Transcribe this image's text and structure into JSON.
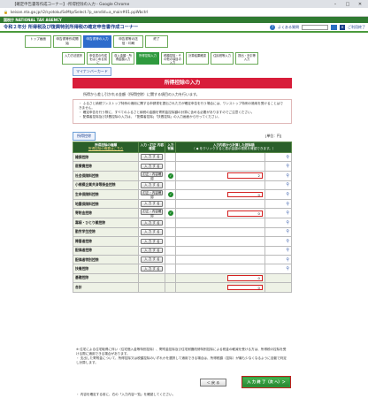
{
  "window": {
    "title": "【確定申告書等作成コーナー】-所得控除の入力 - Google Chrome",
    "url": "keisan.nta.go.jp/r2/syotoku/SsMtp/Select.?p_sendid=a_main#01.ppWbctrl"
  },
  "header": {
    "agency": "国税庁  NATIONAL TAX AGENCY",
    "app_title": "令和２年分  所得税及び復興特別所得税の確定申告書作成コーナー",
    "help_label": "よくある質問",
    "close_label": "ご利用終了"
  },
  "steps_top": [
    {
      "label": "トップ画面"
    },
    {
      "label": "申告書等作成開始"
    },
    {
      "label": "申告書等の入力",
      "current": true
    },
    {
      "label": "申告書等の送信・印刷"
    },
    {
      "label": "終了"
    }
  ],
  "steps_sub": [
    {
      "label": "入力方法選択"
    },
    {
      "label": "申告書の作成をはじめる前に"
    },
    {
      "label": "収入金額・所得金額入力"
    },
    {
      "label": "所得控除入力",
      "current": true
    },
    {
      "label": "税額控除・その他の項目の入力"
    },
    {
      "label": "計算結果確認"
    },
    {
      "label": "住民税等入力"
    },
    {
      "label": "提出・天引等入力"
    }
  ],
  "mynumber_label": "マイナンバーカード",
  "page_title": "所得控除の入力",
  "intro": "所得から差し引かれる金額（所得控除）に関する項目の入力を行います。",
  "notes": [
    "・ ふるさと納税ワンストップ特例の適用に関する申請書を提出された方が確定申告を行う場合には、ワンストップ特例の適用を受けることはできません。",
    "・ 確定申告を行う際に、すべてのふるさと納税の金額を寄附金控除額の計算に含める必要がありますのでご注意ください。",
    "・ 配偶者控除及び扶養控除の入力は、「配偶者控除」「扶養控除」の入力画面から行ってください。"
  ],
  "tab_label": "所得控除",
  "unit_label": "[単位：円]",
  "table": {
    "headers": {
      "kind": "所得控除の種類",
      "kind_link": "所得控除の概要はこちら",
      "input": "入力・訂正 内容確認",
      "entered": "入力 有無",
      "amount": "入力内容から計算した控除額",
      "amount_note": "（ ◆ をクリックすると表示金額の根拠を確認できます。）"
    },
    "rows": [
      {
        "name": "雑損控除",
        "button": "入 力 す る",
        "checked": false,
        "amount": ""
      },
      {
        "name": "医療費控除",
        "button": "入 力 す る",
        "checked": false,
        "amount": ""
      },
      {
        "name": "社会保険料控除",
        "button": "訂正・内容確認",
        "checked": true,
        "amount": "2"
      },
      {
        "name": "小規模企業共済等掛金控除",
        "button": "入 力 す る",
        "checked": false,
        "amount": ""
      },
      {
        "name": "生命保険料控除",
        "button": "訂正・内容確認",
        "checked": true,
        "amount": "0"
      },
      {
        "name": "地震保険料控除",
        "button": "入 力 す る",
        "checked": false,
        "amount": ""
      },
      {
        "name": "寄附金控除",
        "button": "訂正・内容確認",
        "checked": true,
        "amount": "0"
      },
      {
        "name": "寡婦・ひとり親控除",
        "button": "入 力 す る",
        "checked": false,
        "amount": ""
      },
      {
        "name": "勤労学生控除",
        "button": "入 力 す る",
        "checked": false,
        "amount": ""
      },
      {
        "name": "障害者控除",
        "button": "入 力 す る",
        "checked": false,
        "amount": ""
      },
      {
        "name": "配偶者控除",
        "button": "入 力 す る",
        "checked": false,
        "amount": ""
      },
      {
        "name": "配偶者特別控除",
        "button": "入 力 す る",
        "checked": false,
        "amount": ""
      },
      {
        "name": "扶養控除",
        "button": "入 力 す る",
        "checked": false,
        "amount": ""
      },
      {
        "name": "基礎控除",
        "button": "",
        "checked": false,
        "amount": "0"
      },
      {
        "name": "合計",
        "button": "",
        "checked": false,
        "amount": "0"
      }
    ]
  },
  "footnote": "※ 住宅による住宅取得に伴い（住宅借入金等特別控除）、寄附金控除及び住宅耐震改修特別控除による税金の軽減を受ける方は、所得税の控除を受ける際に適用できる場合があります。\n・ 支出した寄附金について、所得控除又は税額控除のいずれかを選択して適用できる場合は、所得税額（控除）が最も少なくなるように自動で判定し計算します。",
  "back_label": "＜  戻 る",
  "next_label": "入 力 終 了（次 へ）＞",
  "bottom_text": "・ 内容を確定する前に、右の「入力内容一覧」を確認してください。",
  "colors": {
    "brand_green": "#2f7a31",
    "title_red": "#d81d3a",
    "step_blue": "#2e6ccc"
  }
}
